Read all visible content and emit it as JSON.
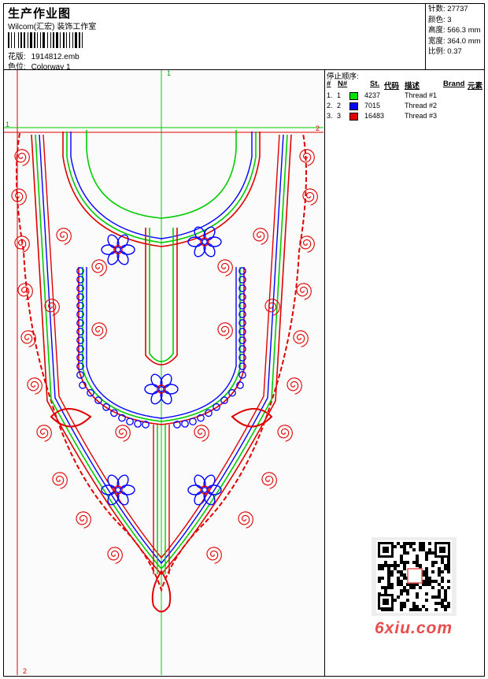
{
  "header": {
    "title": "生产作业图",
    "company": "Wilcom(汇宏) 装饰工作室",
    "design_label": "花版:",
    "design_value": "1914812.emb",
    "colorway_label": "色位:",
    "colorway_value": "Colorway 1"
  },
  "specs": [
    {
      "label": "针数:",
      "value": "27737"
    },
    {
      "label": "颜色:",
      "value": "3"
    },
    {
      "label": "高度:",
      "value": "566.3 mm"
    },
    {
      "label": "宽度:",
      "value": "364.0 mm"
    },
    {
      "label": "比例:",
      "value": "0.37"
    }
  ],
  "thread_panel": {
    "title": "停止顺序:",
    "columns": [
      "#",
      "N#",
      "St.",
      "代码",
      "描述",
      "Brand",
      "元素"
    ],
    "rows": [
      {
        "index": "1.",
        "n": "1",
        "color": "#00e000",
        "code": "4237",
        "desc": "Thread #1"
      },
      {
        "index": "2.",
        "n": "2",
        "color": "#0000ff",
        "code": "7015",
        "desc": "Thread #2"
      },
      {
        "index": "3.",
        "n": "3",
        "color": "#e00000",
        "code": "16483",
        "desc": "Thread #3"
      }
    ]
  },
  "guides": {
    "top_mark": "1",
    "left_mark": "1",
    "right_mark": "2",
    "bottom_mark": "2"
  },
  "watermark": {
    "text": "6xiu.com"
  },
  "colors": {
    "green": "#00cc00",
    "blue": "#0000ff",
    "red": "#e00000"
  }
}
